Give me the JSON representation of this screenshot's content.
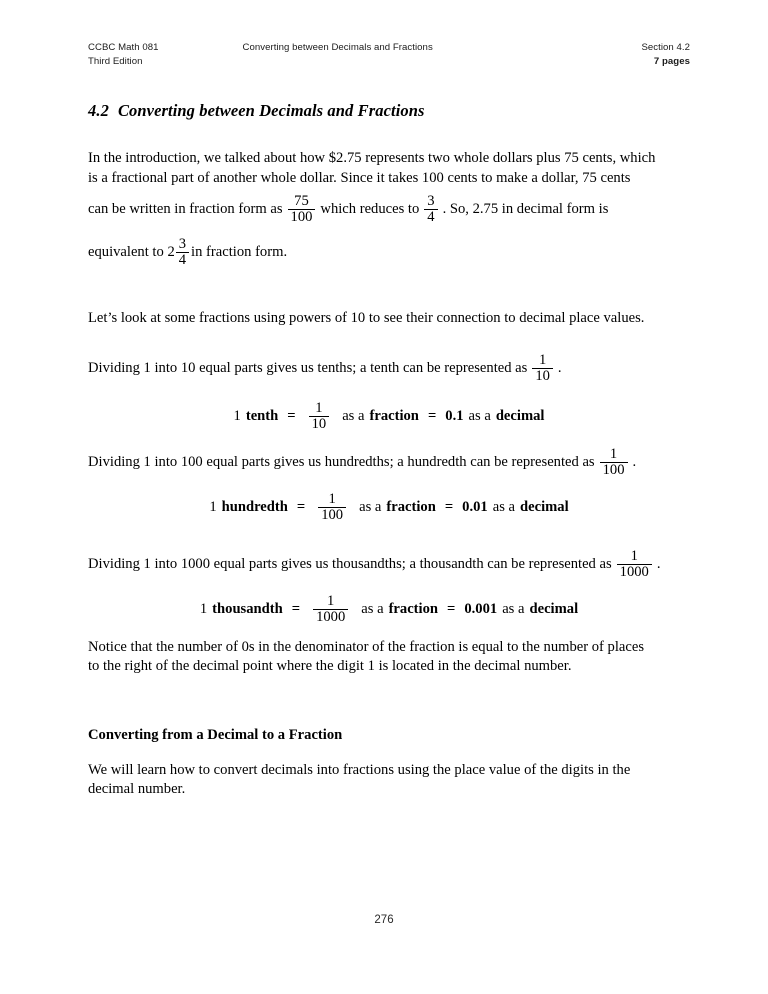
{
  "document": {
    "page_number": "276",
    "page_background": "#ffffff",
    "text_color": "#000000"
  },
  "running_head": {
    "left_line1": "CCBC Math 081",
    "left_line2": "Third Edition",
    "center": "Converting between Decimals and Fractions",
    "right_line1": "Section 4.2",
    "right_line2": "7 pages"
  },
  "section_title": {
    "number": "4.2",
    "text": "Converting between Decimals and Fractions"
  },
  "intro": {
    "line1": "In the introduction, we talked about how $2.75 represents two whole dollars plus 75 cents, which",
    "line2": "is a fractional part of another whole dollar.  Since it takes 100 cents to make a dollar, 75 cents",
    "line3_a": "can be written in fraction form as",
    "line3_frac_num": "75",
    "line3_frac_den": "100",
    "line3_b": "which reduces to",
    "line3_frac2_num": "3",
    "line3_frac2_den": "4",
    "line3_c": ".  So, 2.75 in decimal form is",
    "line4_a": "equivalent to",
    "line4_whole": "2",
    "line4_frac_num": "3",
    "line4_frac_den": "4",
    "line4_b": "in fraction form."
  },
  "lead_in": {
    "text": "Let’s look at some fractions using powers of 10 to see their connection to decimal place values."
  },
  "tenths": {
    "sentence_a": "Dividing 1 into 10 equal parts gives us tenths; a tenth can be represented as",
    "frac_num": "1",
    "frac_den": "10",
    "sentence_b": ".",
    "eq_count": "1",
    "eq_name": "tenth",
    "eq_equals1": "=",
    "eq_frac_num": "1",
    "eq_frac_den": "10",
    "eq_as_a_1": "as a",
    "eq_fraction_word": "fraction",
    "eq_equals2": "=",
    "eq_decimal_value": "0.1",
    "eq_as_a_2": "as a",
    "eq_decimal_word": "decimal"
  },
  "hundredths": {
    "sentence_a": "Dividing 1 into 100 equal parts gives us hundredths; a hundredth can be represented as",
    "frac_num": "1",
    "frac_den": "100",
    "sentence_b": ".",
    "eq_count": "1",
    "eq_name": "hundredth",
    "eq_equals1": "=",
    "eq_frac_num": "1",
    "eq_frac_den": "100",
    "eq_as_a_1": "as a",
    "eq_fraction_word": "fraction",
    "eq_equals2": "=",
    "eq_decimal_value": "0.01",
    "eq_as_a_2": "as a",
    "eq_decimal_word": "decimal"
  },
  "thousandths": {
    "sentence_a": "Dividing 1 into 1000 equal parts gives us thousandths; a thousandth can be represented as",
    "frac_num": "1",
    "frac_den": "1000",
    "sentence_b": ".",
    "eq_count": "1",
    "eq_name": "thousandth",
    "eq_equals1": "=",
    "eq_frac_num": "1",
    "eq_frac_den": "1000",
    "eq_as_a_1": "as a",
    "eq_fraction_word": "fraction",
    "eq_equals2": "=",
    "eq_decimal_value": "0.001",
    "eq_as_a_2": "as a",
    "eq_decimal_word": "decimal"
  },
  "notice": {
    "line1": "Notice that the number of 0s in the denominator of the fraction is equal to the number of places",
    "line2": "to the right of the decimal point where the digit 1 is located in the decimal number."
  },
  "converting_section": {
    "heading": "Converting from a Decimal to a Fraction",
    "body_line1": "We will learn how to convert decimals into fractions using the place value of the digits in the",
    "body_line2": "decimal number."
  }
}
